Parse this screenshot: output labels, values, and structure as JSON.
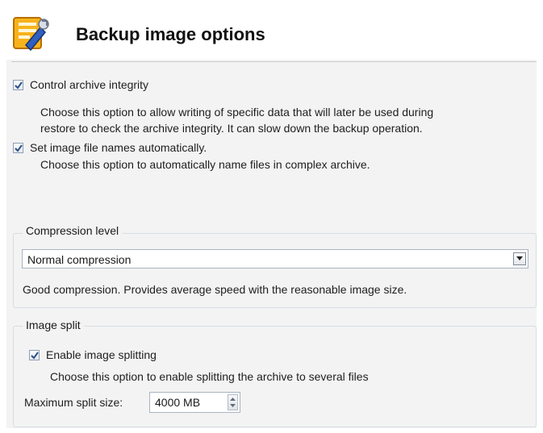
{
  "header": {
    "title": "Backup image options",
    "icon": "wizard-settings-icon"
  },
  "options": {
    "control_integrity": {
      "label": "Control archive integrity",
      "checked": true,
      "description_line1": "Choose this option to allow writing of specific data that will later be used during",
      "description_line2": "restore to check the archive integrity. It can slow down the backup operation."
    },
    "auto_names": {
      "label": "Set image file names automatically.",
      "checked": true,
      "description": "Choose this option to automatically name files in complex archive."
    }
  },
  "compression": {
    "group_label": "Compression level",
    "selected": "Normal compression",
    "description": "Good compression. Provides average speed with the reasonable image size."
  },
  "split": {
    "group_label": "Image split",
    "enable_label": "Enable image splitting",
    "enable_checked": true,
    "description": "Choose this option to enable splitting the archive to several files",
    "max_size_label": "Maximum split size:",
    "max_size_value": "4000 MB"
  },
  "colors": {
    "panel_bg": "#f3f3f3",
    "check_mark": "#2b4f8a",
    "group_border": "#d7dde5"
  }
}
